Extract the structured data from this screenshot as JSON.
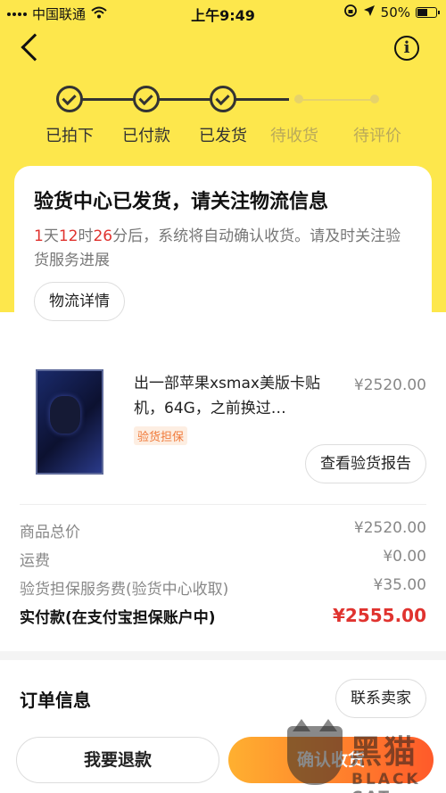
{
  "status_bar": {
    "carrier": "中国联通",
    "time": "上午9:49",
    "battery": "50%",
    "battery_level": 0.5
  },
  "nav": {
    "back_icon": "chevron-left-icon",
    "info_icon": "info-icon"
  },
  "steps": [
    {
      "label": "已拍下",
      "done": true
    },
    {
      "label": "已付款",
      "done": true
    },
    {
      "label": "已发货",
      "done": true
    },
    {
      "label": "待收货",
      "done": false
    },
    {
      "label": "待评价",
      "done": false
    }
  ],
  "notice": {
    "title": "验货中心已发货，请关注物流信息",
    "days": "1",
    "days_unit": "天",
    "hours": "12",
    "hours_unit": "时",
    "minutes": "26",
    "minutes_unit": "分后，系统将自动确认收货。请及时关注验货服务进展",
    "logistics_button": "物流详情"
  },
  "product": {
    "title": "出一部苹果xsmax美版卡贴机，64G，之前换过…",
    "badge": "验货担保",
    "price": "¥2520.00",
    "report_button": "查看验货报告"
  },
  "fees": {
    "goods_total_label": "商品总价",
    "goods_total_value": "¥2520.00",
    "shipping_label": "运费",
    "shipping_value": "¥0.00",
    "service_label": "验货担保服务费(验货中心收取)",
    "service_value": "¥35.00",
    "paid_label": "实付款(在支付宝担保账户中)",
    "paid_value": "¥2555.00"
  },
  "order": {
    "title": "订单信息",
    "contact_button": "联系卖家"
  },
  "bottom": {
    "refund_button": "我要退款",
    "confirm_button": "确认收货"
  },
  "watermark": {
    "cn": "黑猫",
    "en": "BLACK CAT"
  }
}
